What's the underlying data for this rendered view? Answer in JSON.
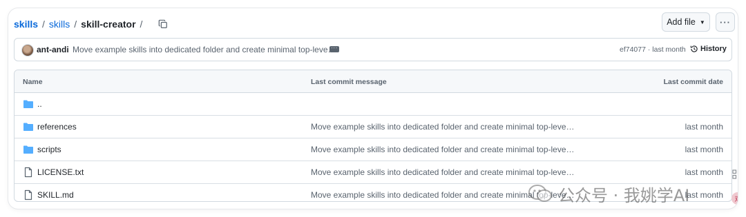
{
  "breadcrumb": {
    "repo": "skills",
    "folder": "skills",
    "current": "skill-creator",
    "separator": "/"
  },
  "toolbar": {
    "add_file_label": "Add file",
    "more_label": "···"
  },
  "commit": {
    "author": "ant-andi",
    "message": "Move example skills into dedicated folder and create minimal top-leve…",
    "hash_and_time": "ef74077 · last month",
    "history_label": "History"
  },
  "table": {
    "headers": {
      "name": "Name",
      "message": "Last commit message",
      "date": "Last commit date"
    },
    "rows": [
      {
        "type": "folder",
        "name": "..",
        "message": "",
        "date": ""
      },
      {
        "type": "folder",
        "name": "references",
        "message": "Move example skills into dedicated folder and create minimal top-leve…",
        "date": "last month"
      },
      {
        "type": "folder",
        "name": "scripts",
        "message": "Move example skills into dedicated folder and create minimal top-leve…",
        "date": "last month"
      },
      {
        "type": "file",
        "name": "LICENSE.txt",
        "message": "Move example skills into dedicated folder and create minimal top-leve…",
        "date": "last month"
      },
      {
        "type": "file",
        "name": "SKILL.md",
        "message": "Move example skills into dedicated folder and create minimal top-leve…",
        "date": "last month"
      }
    ]
  },
  "watermark": {
    "text": "公众号 · 我姚学AI"
  },
  "colors": {
    "link": "#0969da",
    "folder_icon": "#54aeff",
    "muted_text": "#59636e",
    "border": "#d1d9e0"
  },
  "icons": {
    "copy": "copy-icon",
    "history": "history-icon",
    "folder": "folder-icon",
    "file": "file-icon"
  }
}
